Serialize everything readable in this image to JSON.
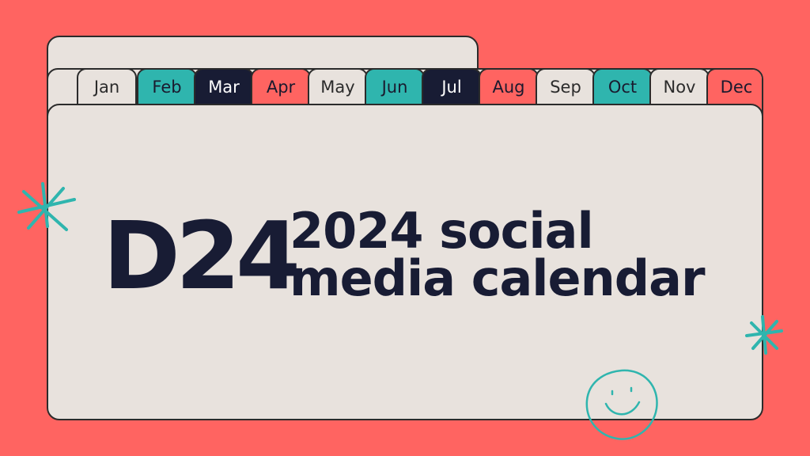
{
  "brand": {
    "logo_text": "D24",
    "colors": {
      "background": "#ff6461",
      "card": "#e8e2dd",
      "teal": "#2fb5ae",
      "navy": "#181c34",
      "outline": "#2b2b2b"
    }
  },
  "title": {
    "line1": "2024 social",
    "line2": "media calendar"
  },
  "months": [
    {
      "label": "Jan",
      "style": "light"
    },
    {
      "label": "Feb",
      "style": "teal"
    },
    {
      "label": "Mar",
      "style": "navy"
    },
    {
      "label": "Apr",
      "style": "coral"
    },
    {
      "label": "May",
      "style": "light"
    },
    {
      "label": "Jun",
      "style": "teal"
    },
    {
      "label": "Jul",
      "style": "navy"
    },
    {
      "label": "Aug",
      "style": "coral"
    },
    {
      "label": "Sep",
      "style": "light"
    },
    {
      "label": "Oct",
      "style": "teal"
    },
    {
      "label": "Nov",
      "style": "light"
    },
    {
      "label": "Dec",
      "style": "coral"
    }
  ],
  "decorations": [
    "sparkle-icon",
    "sparkle-icon",
    "smiley-icon"
  ]
}
